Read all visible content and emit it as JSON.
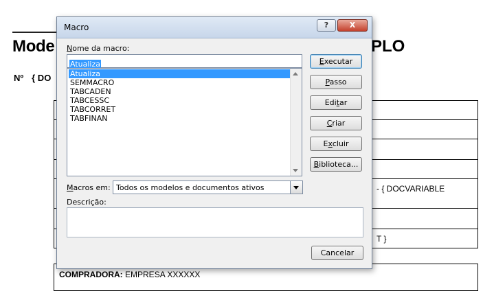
{
  "document": {
    "title_left": "Mode",
    "title_right": "PLO",
    "number_label": "Nº",
    "number_var": "{ DO",
    "row_text_1": "- { DOCVARIABLE",
    "row_text_2": "T }",
    "compradora_label": "COMPRADORA:",
    "compradora_value": "EMPRESA XXXXXX"
  },
  "dialog": {
    "title": "Macro",
    "help_label": "?",
    "close_label": "X",
    "name_label_u": "N",
    "name_label_rest": "ome da macro:",
    "name_value": "Atualiza",
    "macros": [
      "Atualiza",
      "SEMMACRO",
      "TABCADEN",
      "TABCESSC",
      "TABCORRET",
      "TABFINAN"
    ],
    "macros_in_label_u": "M",
    "macros_in_label_rest": "acros em:",
    "macros_in_value": "Todos os modelos e documentos ativos",
    "description_label": "Descrição:",
    "buttons": {
      "run_u": "E",
      "run_rest": "xecutar",
      "step_u": "P",
      "step_rest": "asso",
      "edit_pre": "Edi",
      "edit_u": "t",
      "edit_rest": "ar",
      "create_u": "C",
      "create_rest": "riar",
      "delete_pre": "E",
      "delete_u": "x",
      "delete_rest": "cluir",
      "organizer_u": "B",
      "organizer_rest": "iblioteca...",
      "cancel": "Cancelar"
    }
  }
}
